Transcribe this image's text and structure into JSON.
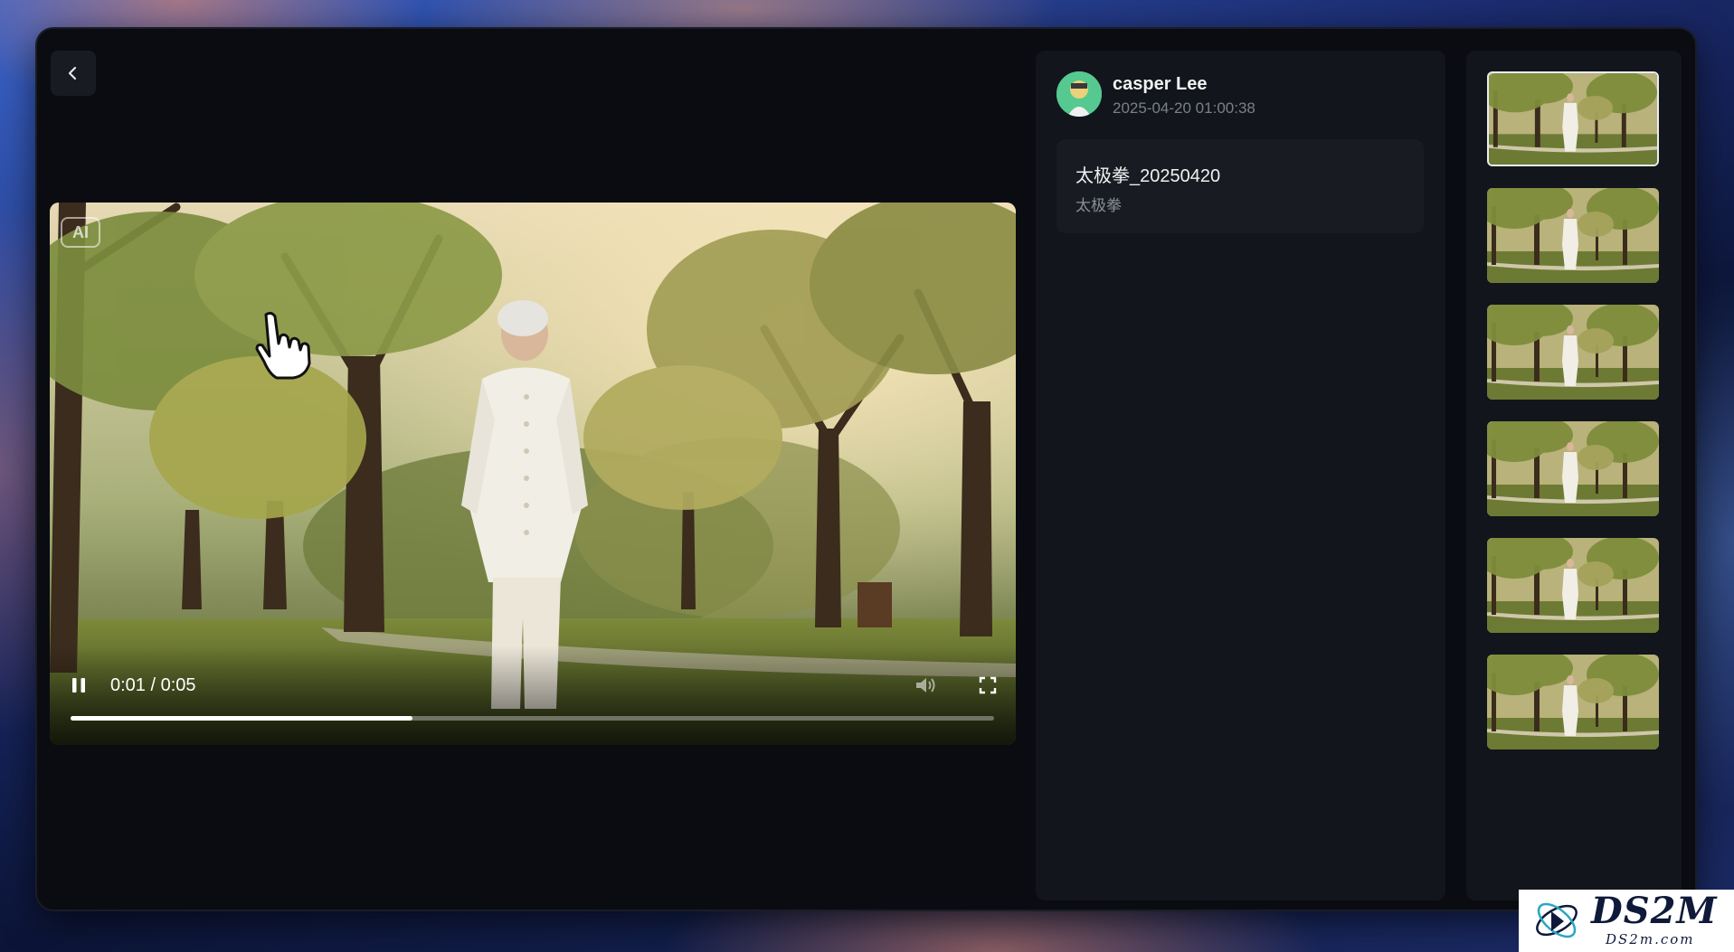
{
  "player": {
    "ai_badge": "AI",
    "current_time": "0:01",
    "duration": "0:05",
    "time_display": "0:01 / 0:05",
    "progress_fraction": 0.37
  },
  "info": {
    "user_name": "casper Lee",
    "timestamp": "2025-04-20 01:00:38",
    "card_title": "太极拳_20250420",
    "card_subtitle": "太极拳"
  },
  "thumbnails": {
    "count": 6,
    "active_index": 0
  },
  "watermark": {
    "brand": "DS2M",
    "domain": "DS2m.com"
  },
  "icons": {
    "back": "chevron-left-icon",
    "play_state": "pause-icon",
    "volume": "volume-icon",
    "fullscreen": "fullscreen-icon"
  },
  "colors": {
    "window_bg": "#0a0c12",
    "panel_bg": "#12151c",
    "card_bg": "#181b22",
    "avatar_bg": "#55c98f"
  }
}
